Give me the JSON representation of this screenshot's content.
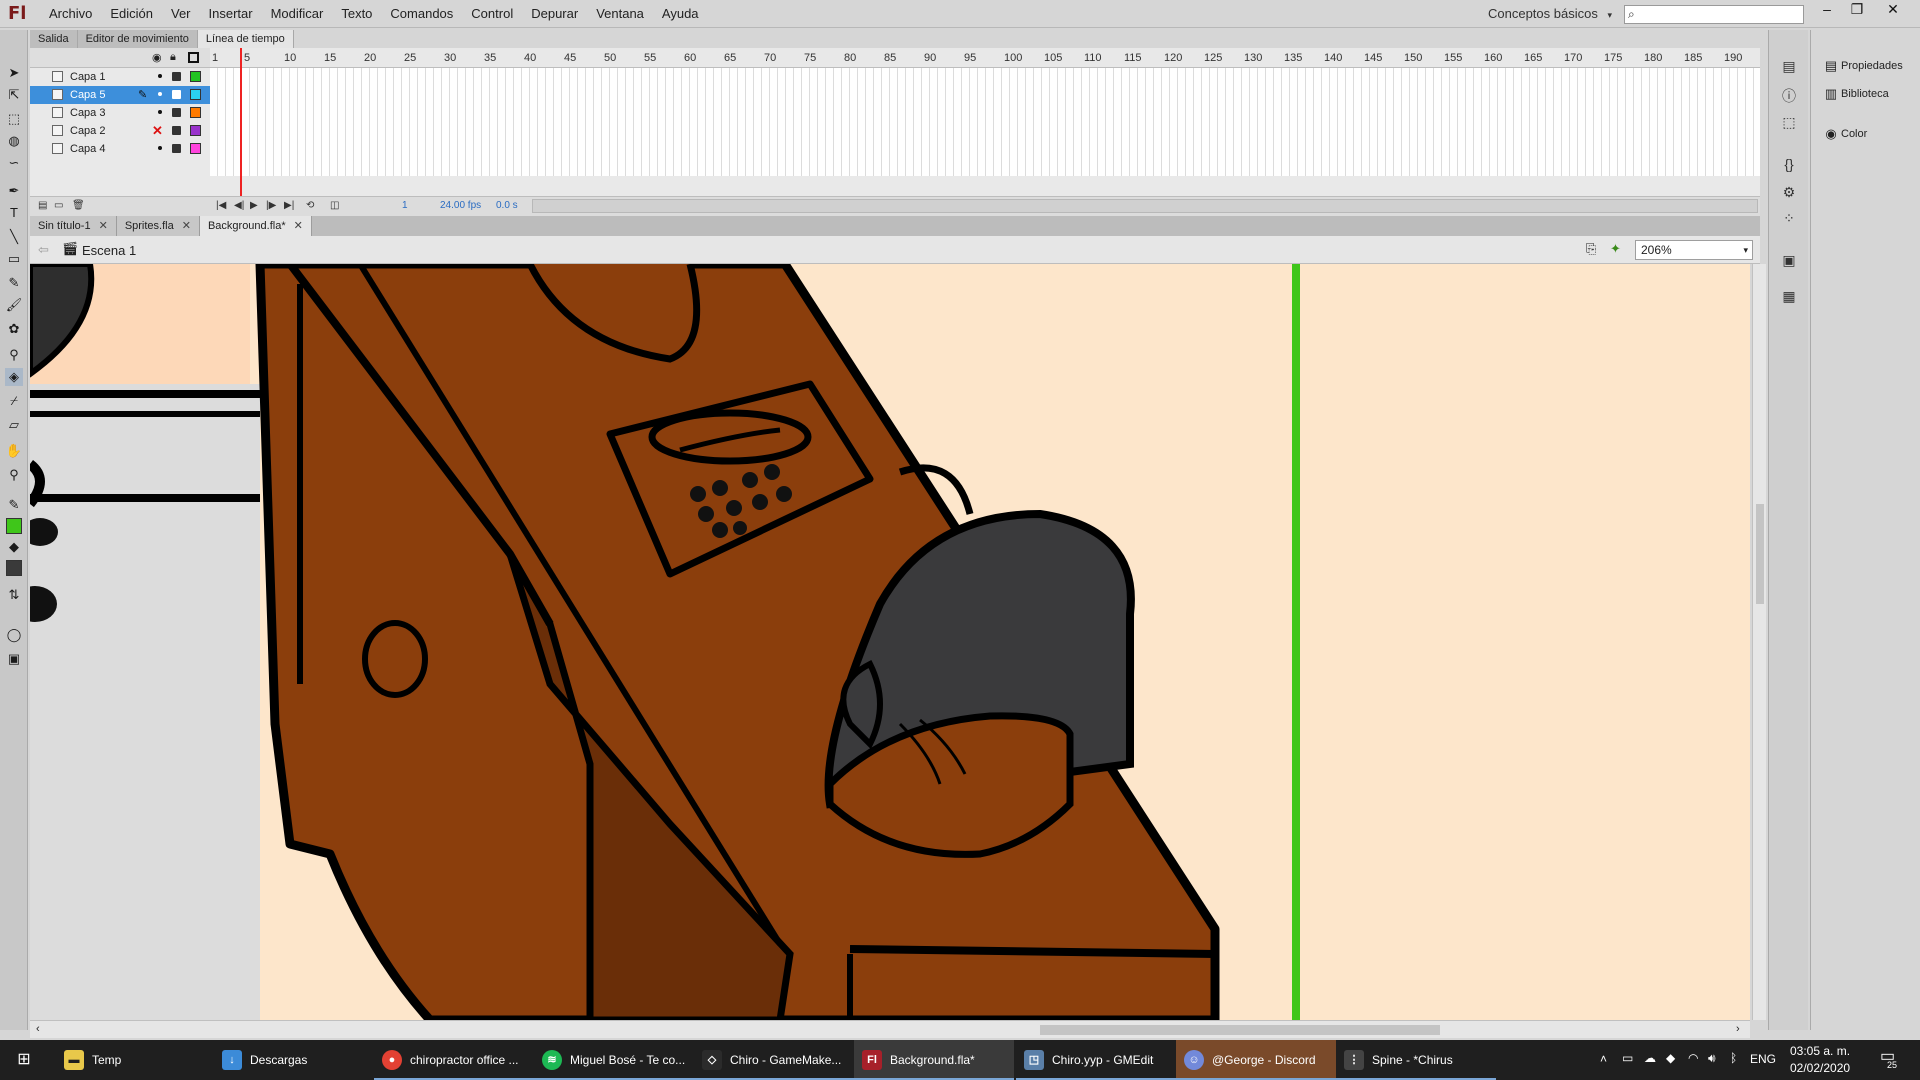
{
  "app": {
    "logo": "Fl"
  },
  "menu": [
    "Archivo",
    "Edición",
    "Ver",
    "Insertar",
    "Modificar",
    "Texto",
    "Comandos",
    "Control",
    "Depurar",
    "Ventana",
    "Ayuda"
  ],
  "workspace": {
    "value": "Conceptos básicos"
  },
  "window_buttons": {
    "minimize": "–",
    "restore": "❐",
    "close": "✕"
  },
  "panel_tabs": [
    {
      "label": "Salida",
      "active": false
    },
    {
      "label": "Editor de movimiento",
      "active": false
    },
    {
      "label": "Línea de tiempo",
      "active": true
    }
  ],
  "layers": [
    {
      "name": "Capa 1",
      "color": "#22c422",
      "selected": false
    },
    {
      "name": "Capa 5",
      "color": "#2ad2f0",
      "selected": true
    },
    {
      "name": "Capa 3",
      "color": "#ff7a00",
      "selected": false
    },
    {
      "name": "Capa 2",
      "color": "#9933cc",
      "selected": false,
      "hidden": true
    },
    {
      "name": "Capa 4",
      "color": "#ff44dd",
      "selected": false
    }
  ],
  "frame_ticks": [
    "1",
    "5",
    "10",
    "15",
    "20",
    "25",
    "30",
    "35",
    "40",
    "45",
    "50",
    "55",
    "60",
    "65",
    "70",
    "75",
    "80",
    "85",
    "90",
    "95",
    "100",
    "105",
    "110",
    "115",
    "120",
    "125",
    "130",
    "135",
    "140",
    "145",
    "150",
    "155",
    "160",
    "165",
    "170",
    "175",
    "180",
    "185",
    "190"
  ],
  "timeline_status": {
    "frame": "1",
    "fps": "24.00 fps",
    "time": "0.0 s"
  },
  "doc_tabs": [
    {
      "label": "Sin título-1",
      "active": false
    },
    {
      "label": "Sprites.fla",
      "active": false
    },
    {
      "label": "Background.fla*",
      "active": true
    }
  ],
  "edit_bar": {
    "scene": "Escena 1",
    "zoom": "206%"
  },
  "right_panel": [
    {
      "label": "Propiedades",
      "icon": "properties-icon"
    },
    {
      "label": "Biblioteca",
      "icon": "library-icon"
    },
    {
      "label": "Color",
      "icon": "color-icon"
    }
  ],
  "taskbar": {
    "apps": [
      {
        "label": "Temp",
        "color": "#e8c84a",
        "icon": "folder-icon"
      },
      {
        "label": "Descargas",
        "color": "#3c8bd8",
        "icon": "download-icon"
      },
      {
        "label": "chiropractor office ...",
        "color": "#e34133",
        "icon": "chrome-icon"
      },
      {
        "label": "Miguel Bosé - Te co...",
        "color": "#1db954",
        "icon": "spotify-icon"
      },
      {
        "label": "Chiro - GameMake...",
        "color": "#ffffff",
        "icon": "gamemaker-icon"
      },
      {
        "label": "Background.fla*",
        "color": "#a7202a",
        "icon": "animate-icon"
      },
      {
        "label": "Chiro.yyp - GMEdit",
        "color": "#5a7fa8",
        "icon": "gmedit-icon"
      },
      {
        "label": "@George - Discord",
        "color": "#7289da",
        "icon": "discord-icon"
      },
      {
        "label": "Spine - *Chirus",
        "color": "#cccccc",
        "icon": "spine-icon"
      }
    ],
    "tray": {
      "lang": "ENG",
      "time": "03:05 a. m.",
      "date": "02/02/2020",
      "notifications": "25"
    }
  },
  "colors": {
    "stage_bg": "#fde6cb",
    "wood_light": "#8b3e0c",
    "wood_dark": "#6a2e08",
    "outline": "#000000",
    "guide_green": "#3fc61a",
    "phone_handset": "#3a3a3c"
  }
}
